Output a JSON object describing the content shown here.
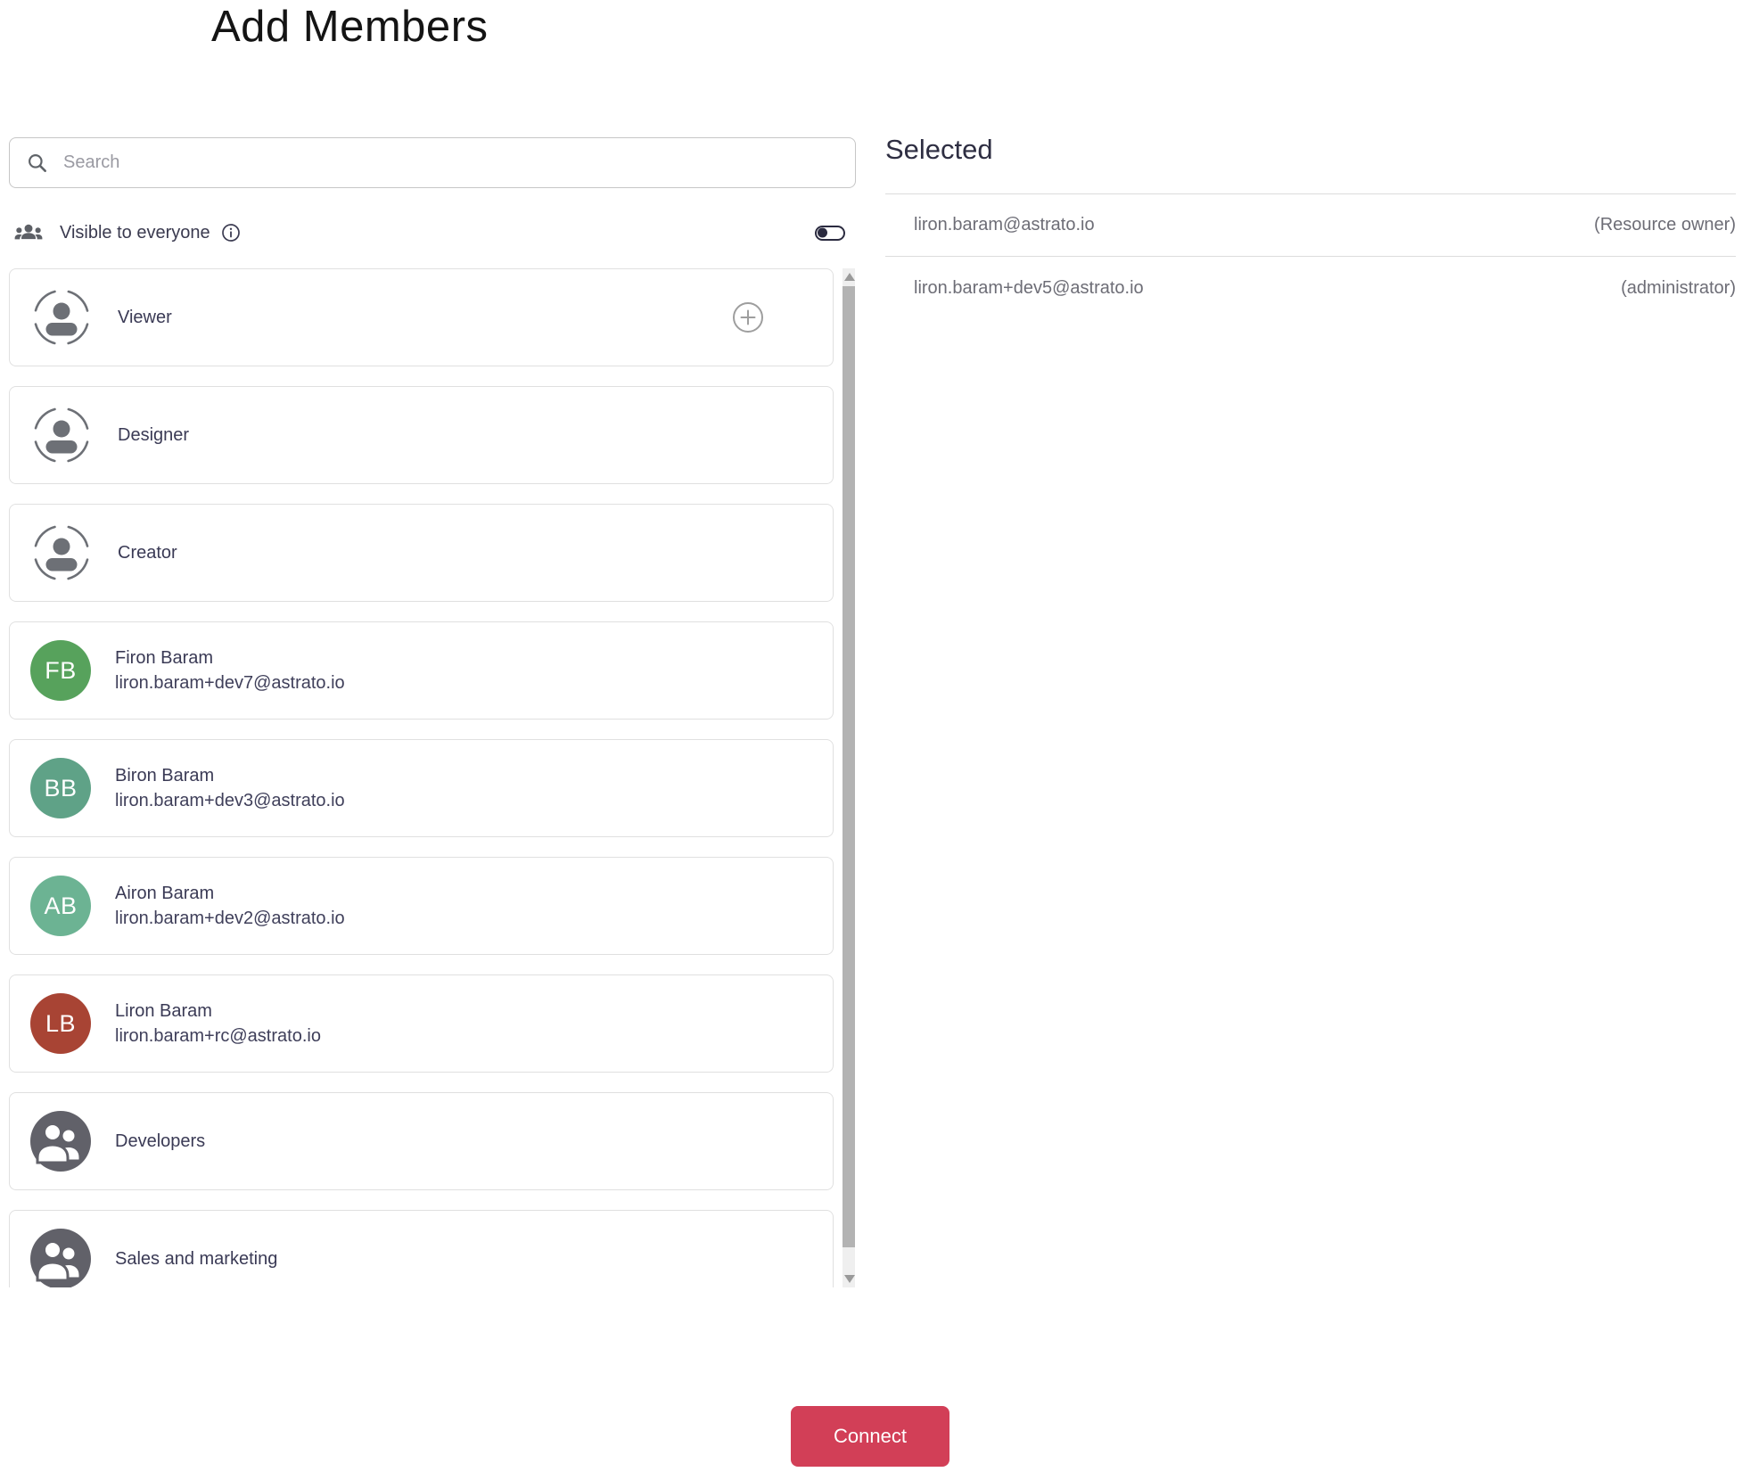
{
  "page": {
    "title": "Add Members"
  },
  "search": {
    "placeholder": "Search",
    "value": ""
  },
  "visibility": {
    "label": "Visible to everyone",
    "toggle_on": false
  },
  "directory": {
    "roles": [
      {
        "label": "Viewer",
        "has_add_button": true
      },
      {
        "label": "Designer"
      },
      {
        "label": "Creator"
      }
    ],
    "users": [
      {
        "initials": "FB",
        "name": "Firon Baram",
        "email": "liron.baram+dev7@astrato.io",
        "color": "#57a25c"
      },
      {
        "initials": "BB",
        "name": "Biron Baram",
        "email": "liron.baram+dev3@astrato.io",
        "color": "#5fa287"
      },
      {
        "initials": "AB",
        "name": "Airon Baram",
        "email": "liron.baram+dev2@astrato.io",
        "color": "#6cb393"
      },
      {
        "initials": "LB",
        "name": "Liron Baram",
        "email": "liron.baram+rc@astrato.io",
        "color": "#a84434"
      }
    ],
    "groups": [
      {
        "label": "Developers"
      },
      {
        "label": "Sales and marketing"
      }
    ]
  },
  "selected": {
    "heading": "Selected",
    "members": [
      {
        "email": "liron.baram@astrato.io",
        "role": "(Resource owner)"
      },
      {
        "email": "liron.baram+dev5@astrato.io",
        "role": "(administrator)"
      }
    ]
  },
  "footer": {
    "connect_label": "Connect"
  },
  "colors": {
    "accent": "#d23f57",
    "toggle": "#2b2b40",
    "card_border": "#e0e0e0",
    "text_dark": "#3a3a55",
    "text_gray": "#6d6d76",
    "group_avatar": "#616169",
    "role_icon": "#6d7076"
  }
}
